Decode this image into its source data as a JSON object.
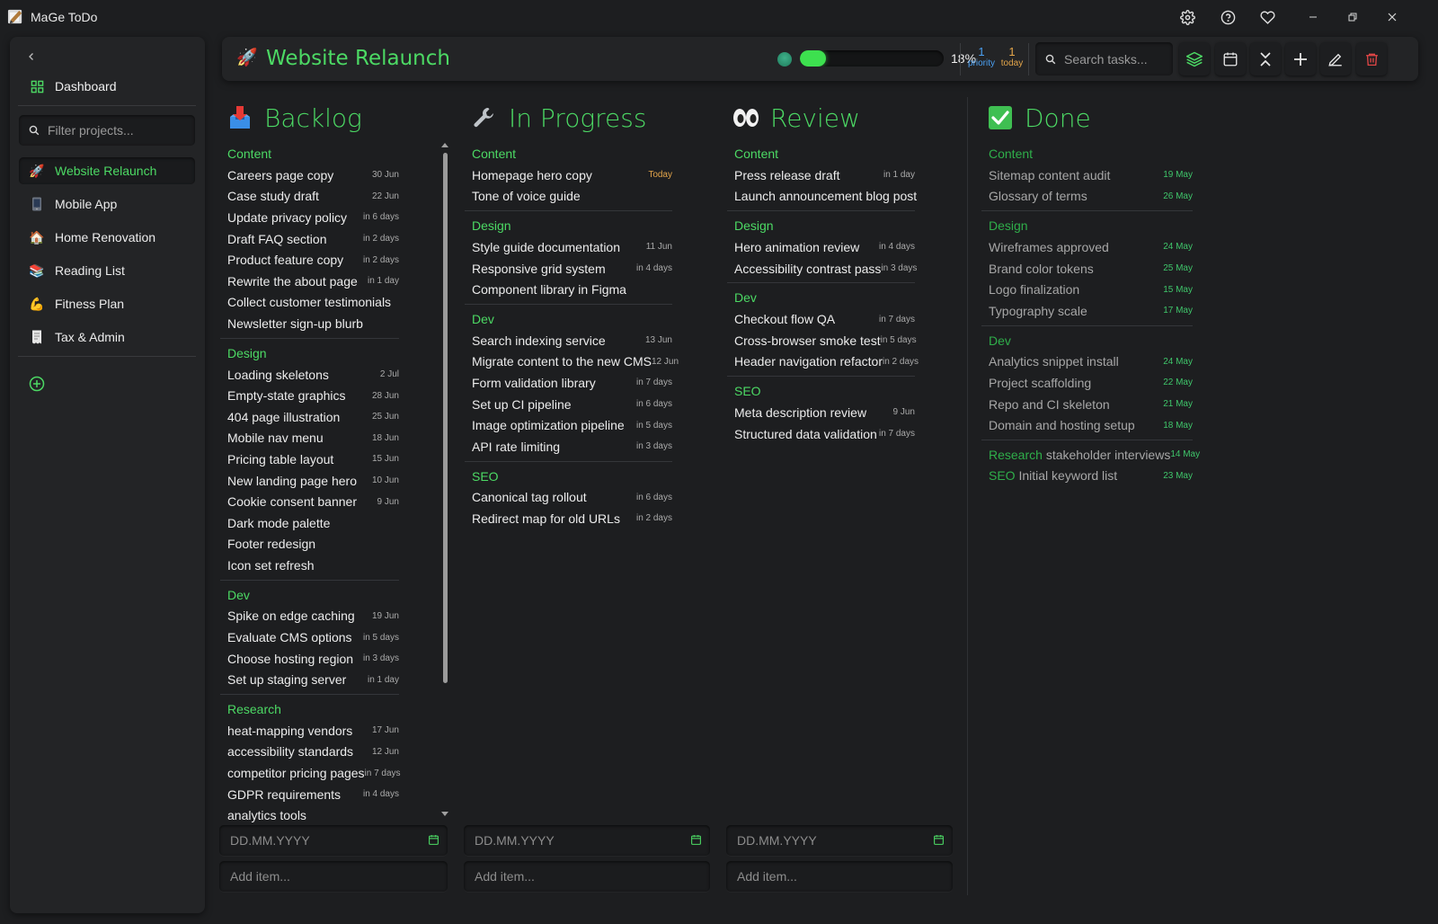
{
  "app": {
    "title": "MaGe ToDo"
  },
  "sidebar": {
    "dashboard_label": "Dashboard",
    "filter_placeholder": "Filter projects...",
    "projects": [
      {
        "label": "Website Relaunch",
        "icon": "rocket-icon",
        "active": true
      },
      {
        "label": "Mobile App",
        "icon": "phone-icon",
        "active": false
      },
      {
        "label": "Home Renovation",
        "icon": "house-icon",
        "active": false
      },
      {
        "label": "Reading List",
        "icon": "books-icon",
        "active": false
      },
      {
        "label": "Fitness Plan",
        "icon": "muscle-icon",
        "active": false
      },
      {
        "label": "Tax & Admin",
        "icon": "receipt-icon",
        "active": false
      }
    ]
  },
  "header": {
    "project_title": "Website Relaunch",
    "progress_percent": 18,
    "progress_label": "18%",
    "priority_count": "1",
    "priority_label": "priority",
    "today_count": "1",
    "today_label": "today",
    "search_placeholder": "Search tasks..."
  },
  "columns": [
    {
      "title": "Backlog",
      "icon": "inbox-tray-icon",
      "groups": [
        {
          "label": "Content",
          "tasks": [
            {
              "title": "Careers page copy",
              "due": "30 Jun"
            },
            {
              "title": "Case study draft",
              "due": "22 Jun"
            },
            {
              "title": "Update privacy policy",
              "due": "in 6 days"
            },
            {
              "title": "Draft FAQ section",
              "due": "in 2 days"
            },
            {
              "title": "Product feature copy",
              "due": "in 2 days"
            },
            {
              "title": "Rewrite the about page",
              "due": "in 1 day"
            },
            {
              "title": "Collect customer testimonials",
              "due": ""
            },
            {
              "title": "Newsletter sign-up blurb",
              "due": ""
            }
          ]
        },
        {
          "label": "Design",
          "tasks": [
            {
              "title": "Loading skeletons",
              "due": "2 Jul"
            },
            {
              "title": "Empty-state graphics",
              "due": "28 Jun"
            },
            {
              "title": "404 page illustration",
              "due": "25 Jun"
            },
            {
              "title": "Mobile nav menu",
              "due": "18 Jun"
            },
            {
              "title": "Pricing table layout",
              "due": "15 Jun"
            },
            {
              "title": "New landing page hero",
              "due": "10 Jun"
            },
            {
              "title": "Cookie consent banner",
              "due": "9 Jun"
            },
            {
              "title": "Dark mode palette",
              "due": ""
            },
            {
              "title": "Footer redesign",
              "due": ""
            },
            {
              "title": "Icon set refresh",
              "due": ""
            }
          ]
        },
        {
          "label": "Dev",
          "tasks": [
            {
              "title": "Spike on edge caching",
              "due": "19 Jun"
            },
            {
              "title": "Evaluate CMS options",
              "due": "in 5 days"
            },
            {
              "title": "Choose hosting region",
              "due": "in 3 days"
            },
            {
              "title": "Set up staging server",
              "due": "in 1 day"
            }
          ]
        },
        {
          "label": "Research",
          "tasks": [
            {
              "title": "heat-mapping vendors",
              "due": "17 Jun"
            },
            {
              "title": "accessibility standards",
              "due": "12 Jun"
            },
            {
              "title": "competitor pricing pages",
              "due": "in 7 days"
            },
            {
              "title": "GDPR requirements",
              "due": "in 4 days"
            },
            {
              "title": "analytics tools",
              "due": ""
            }
          ]
        }
      ]
    },
    {
      "title": "In Progress",
      "icon": "wrench-icon",
      "groups": [
        {
          "label": "Content",
          "tasks": [
            {
              "title": "Homepage hero copy",
              "due": "Today",
              "today": true
            },
            {
              "title": "Tone of voice guide",
              "due": ""
            }
          ]
        },
        {
          "label": "Design",
          "tasks": [
            {
              "title": "Style guide documentation",
              "due": "11 Jun"
            },
            {
              "title": "Responsive grid system",
              "due": "in 4 days"
            },
            {
              "title": "Component library in Figma",
              "due": ""
            }
          ]
        },
        {
          "label": "Dev",
          "tasks": [
            {
              "title": "Search indexing service",
              "due": "13 Jun"
            },
            {
              "title": "Migrate content to the new CMS",
              "due": "12 Jun"
            },
            {
              "title": "Form validation library",
              "due": "in 7 days"
            },
            {
              "title": "Set up CI pipeline",
              "due": "in 6 days"
            },
            {
              "title": "Image optimization pipeline",
              "due": "in 5 days"
            },
            {
              "title": "API rate limiting",
              "due": "in 3 days"
            }
          ]
        },
        {
          "label": "SEO",
          "tasks": [
            {
              "title": "Canonical tag rollout",
              "due": "in 6 days"
            },
            {
              "title": "Redirect map for old URLs",
              "due": "in 2 days"
            }
          ]
        }
      ]
    },
    {
      "title": "Review",
      "icon": "eyes-icon",
      "groups": [
        {
          "label": "Content",
          "tasks": [
            {
              "title": "Press release draft",
              "due": "in 1 day"
            },
            {
              "title": "Launch announcement blog post",
              "due": ""
            }
          ]
        },
        {
          "label": "Design",
          "tasks": [
            {
              "title": "Hero animation review",
              "due": "in 4 days"
            },
            {
              "title": "Accessibility contrast pass",
              "due": "in 3 days"
            }
          ]
        },
        {
          "label": "Dev",
          "tasks": [
            {
              "title": "Checkout flow QA",
              "due": "in 7 days"
            },
            {
              "title": "Cross-browser smoke test",
              "due": "in 5 days"
            },
            {
              "title": "Header navigation refactor",
              "due": "in 2 days"
            }
          ]
        },
        {
          "label": "SEO",
          "tasks": [
            {
              "title": "Meta description review",
              "due": "9 Jun"
            },
            {
              "title": "Structured data validation",
              "due": "in 7 days"
            }
          ]
        }
      ]
    },
    {
      "title": "Done",
      "icon": "check-box-icon",
      "groups": [
        {
          "label": "Content",
          "tasks": [
            {
              "title": "Sitemap content audit",
              "due": "19 May"
            },
            {
              "title": "Glossary of terms",
              "due": "26 May"
            }
          ]
        },
        {
          "label": "Design",
          "tasks": [
            {
              "title": "Wireframes approved",
              "due": "24 May"
            },
            {
              "title": "Brand color tokens",
              "due": "25 May"
            },
            {
              "title": "Logo finalization",
              "due": "15 May"
            },
            {
              "title": "Typography scale",
              "due": "17 May"
            }
          ]
        },
        {
          "label": "Dev",
          "tasks": [
            {
              "title": "Analytics snippet install",
              "due": "24 May"
            },
            {
              "title": "Project scaffolding",
              "due": "22 May"
            },
            {
              "title": "Repo and CI skeleton",
              "due": "21 May"
            },
            {
              "title": "Domain and hosting setup",
              "due": "18 May"
            }
          ]
        }
      ],
      "inline_tasks": [
        {
          "tag": "Research",
          "title": "stakeholder interviews",
          "due": "14 May"
        },
        {
          "tag": "SEO",
          "title": "Initial keyword list",
          "due": "23 May"
        }
      ]
    }
  ],
  "inputs": {
    "date_placeholder": "DD.MM.YYYY",
    "add_placeholder": "Add item..."
  },
  "colors": {
    "accent": "#4cd964",
    "priority": "#4a9ff0",
    "today": "#e3a54a",
    "delete": "#e04646",
    "background": "#1d1e20"
  }
}
